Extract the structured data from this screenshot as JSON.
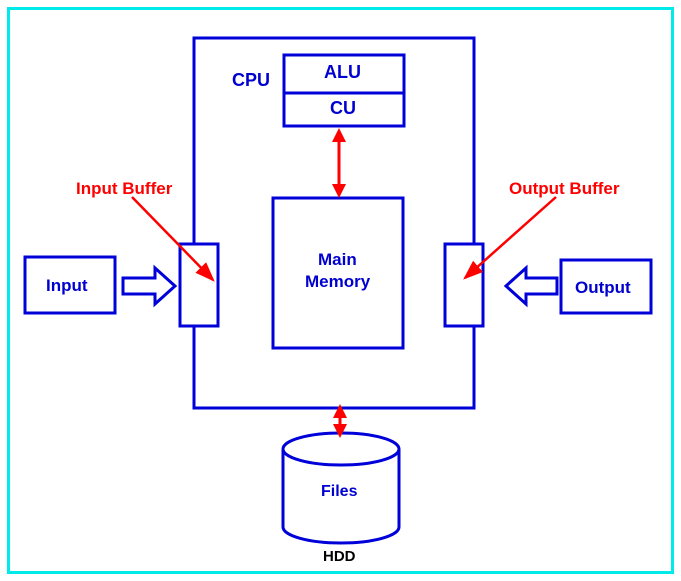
{
  "labels": {
    "cpu": "CPU",
    "alu": "ALU",
    "cu": "CU",
    "inputBuffer": "Input Buffer",
    "outputBuffer": "Output Buffer",
    "input": "Input",
    "output": "Output",
    "mainMemory1": "Main",
    "mainMemory2": "Memory",
    "files": "Files",
    "hdd": "HDD"
  },
  "colors": {
    "borderCyan": "#00eaea",
    "boxBlue": "#0000d9",
    "textBlue": "#0000d0",
    "arrowRed": "#ff0000"
  }
}
